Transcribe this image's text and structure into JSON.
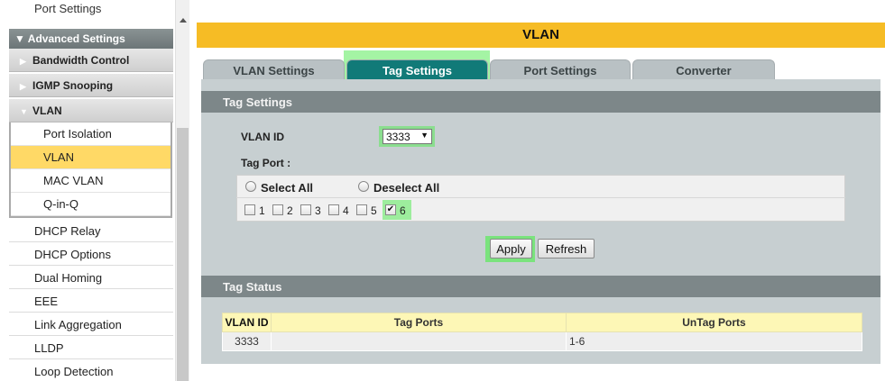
{
  "sidebar": {
    "top_item": "Port Settings",
    "advanced_header": "Advanced Settings",
    "groups": [
      {
        "label": "Bandwidth Control"
      },
      {
        "label": "IGMP Snooping"
      },
      {
        "label": "VLAN"
      }
    ],
    "vlan_sub_items": [
      {
        "label": "Port Isolation"
      },
      {
        "label": "VLAN"
      },
      {
        "label": "MAC VLAN"
      },
      {
        "label": "Q-in-Q"
      }
    ],
    "items": [
      {
        "label": "DHCP Relay"
      },
      {
        "label": "DHCP Options"
      },
      {
        "label": "Dual Homing"
      },
      {
        "label": "EEE"
      },
      {
        "label": "Link Aggregation"
      },
      {
        "label": "LLDP"
      },
      {
        "label": "Loop Detection"
      }
    ]
  },
  "page": {
    "title": "VLAN",
    "tabs": [
      {
        "label": "VLAN Settings"
      },
      {
        "label": "Tag Settings"
      },
      {
        "label": "Port Settings"
      },
      {
        "label": "Converter"
      }
    ],
    "active_tab": "Tag Settings"
  },
  "tag_settings": {
    "section_title": "Tag Settings",
    "vlan_id_label": "VLAN ID",
    "vlan_id_value": "3333",
    "tag_port_label": "Tag Port :",
    "select_all_label": "Select All",
    "deselect_all_label": "Deselect All",
    "ports": [
      {
        "label": "1",
        "checked": false
      },
      {
        "label": "2",
        "checked": false
      },
      {
        "label": "3",
        "checked": false
      },
      {
        "label": "4",
        "checked": false
      },
      {
        "label": "5",
        "checked": false
      },
      {
        "label": "6",
        "checked": true
      }
    ],
    "apply_label": "Apply",
    "refresh_label": "Refresh"
  },
  "tag_status": {
    "section_title": "Tag Status",
    "columns": [
      "VLAN ID",
      "Tag Ports",
      "UnTag Ports"
    ],
    "rows": [
      {
        "vlan_id": "3333",
        "tag_ports": "",
        "untag_ports": "1-6"
      }
    ]
  },
  "colors": {
    "title_bar": "#f6bc25",
    "active_tab": "#117a78",
    "panel_bg": "#c7cfd1",
    "section_head": "#7d8789",
    "highlight": "#5aeb5a",
    "selected_menu": "#ffd966"
  },
  "icons": {
    "collapse_arrow": "triangle-down-icon",
    "expand_arrow": "triangle-right-icon",
    "select_caret": "caret-down-icon",
    "checkmark": "check-icon"
  }
}
